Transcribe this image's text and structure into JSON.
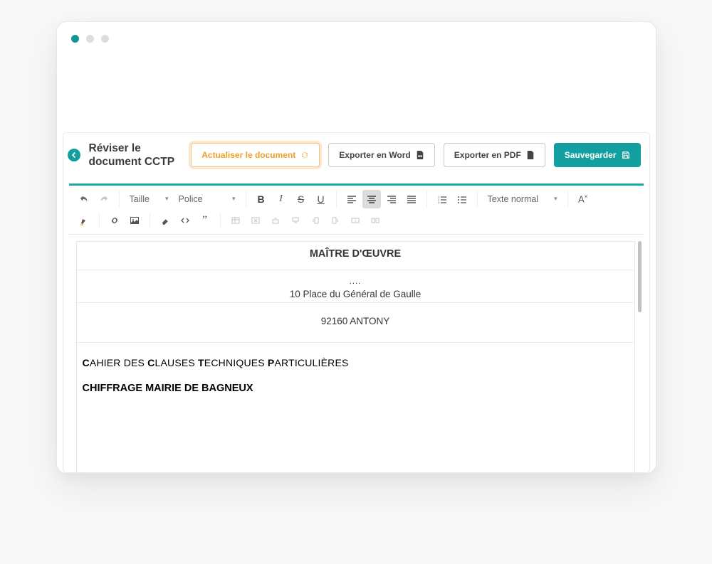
{
  "header": {
    "title": "Réviser le document CCTP",
    "buttons": {
      "refresh": "Actualiser le document",
      "export_word": "Exporter en Word",
      "export_pdf": "Exporter en PDF",
      "save": "Sauvegarder"
    }
  },
  "toolbar": {
    "size": "Taille",
    "font": "Police",
    "style": "Texte normal",
    "clear_format": "A"
  },
  "document": {
    "heading": "MAÎTRE D'ŒUVRE",
    "ellipsis": "....",
    "address_line": "10 Place du Général de Gaulle",
    "city": "92160 ANTONY",
    "cctp": {
      "w1a": "C",
      "w1b": "AHIER DES ",
      "w2a": "C",
      "w2b": "LAUSES ",
      "w3a": "T",
      "w3b": "ECHNIQUES ",
      "w4a": "P",
      "w4b": "ARTICULIÈRES"
    },
    "project": "CHIFFRAGE MAIRIE DE BAGNEUX"
  }
}
